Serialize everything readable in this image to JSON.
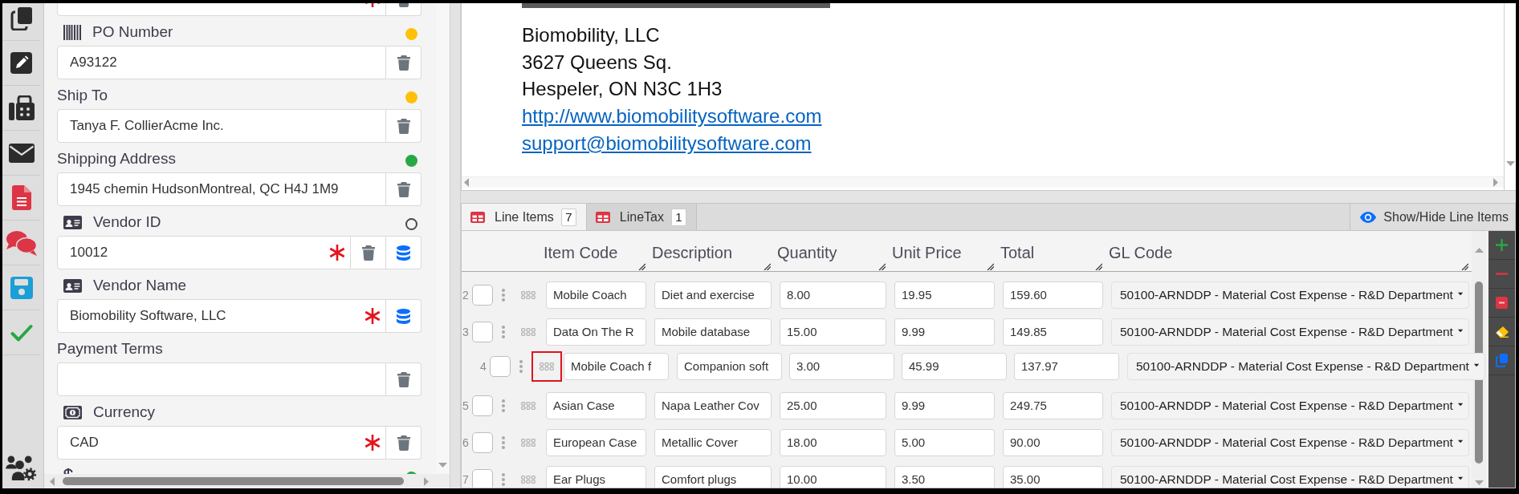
{
  "sidebar": {
    "tools": [
      {
        "kind": "duplicate"
      },
      {
        "kind": "edit"
      },
      {
        "kind": "fax"
      },
      {
        "kind": "email"
      },
      {
        "kind": "pdf"
      },
      {
        "kind": "comments"
      },
      {
        "kind": "save"
      },
      {
        "kind": "approve"
      }
    ],
    "bottom_tool": {
      "kind": "users"
    }
  },
  "form": {
    "fields": [
      {
        "input": {
          "required": true,
          "deletable": true,
          "lookup": false
        }
      },
      {
        "kind": "reference",
        "label": "PO Number",
        "dot": {
          "kind": "filled",
          "color": "#ffc107"
        },
        "input": {
          "value": "A93122",
          "required": false,
          "deletable": true,
          "lookup": false
        }
      },
      {
        "kind": "text",
        "label": "Ship To",
        "dot": {
          "kind": "filled",
          "color": "#ffc107"
        },
        "input": {
          "value": "Tanya F. CollierAcme Inc.",
          "required": false,
          "deletable": true,
          "lookup": false
        }
      },
      {
        "kind": "text",
        "label": "Shipping Address",
        "dot": {
          "kind": "filled",
          "color": "#28a745"
        },
        "input": {
          "value": "1945 chemin HudsonMontreal, QC H4J 1M9",
          "required": false,
          "deletable": true,
          "lookup": false
        }
      },
      {
        "kind": "vendor",
        "label": "Vendor ID",
        "dot": {
          "kind": "hollow",
          "color": "#4a4a4a"
        },
        "input": {
          "value": "10012",
          "required": true,
          "deletable": true,
          "lookup": true
        }
      },
      {
        "kind": "vendor",
        "label": "Vendor Name",
        "input": {
          "value": "Biomobility Software, LLC",
          "required": true,
          "deletable": false,
          "lookup": true
        }
      },
      {
        "kind": "text",
        "label": "Payment Terms",
        "input": {
          "required": false,
          "deletable": true,
          "lookup": false
        }
      },
      {
        "kind": "currency",
        "label": "Currency",
        "input": {
          "value": "CAD",
          "required": true,
          "deletable": true,
          "lookup": false
        }
      },
      {
        "kind": "amount",
        "dot": {
          "kind": "filled",
          "color": "#28a745"
        }
      }
    ]
  },
  "document": {
    "lines": [
      {
        "kind": "text",
        "text": "Biomobility, LLC"
      },
      {
        "kind": "text",
        "text": "3627 Queens Sq."
      },
      {
        "kind": "text",
        "text": "Hespeler, ON N3C 1H3"
      },
      {
        "kind": "link",
        "text": "http://www.biomobilitysoftware.com"
      },
      {
        "kind": "link",
        "text": "support@biomobilitysoftware.com"
      }
    ]
  },
  "line_items": {
    "tabs": [
      {
        "label": "Line Items",
        "count": "7",
        "selected": true
      },
      {
        "label": "LineTax",
        "count": "1",
        "selected": false
      }
    ],
    "show_hide_button": "Show/Hide Line Items",
    "columns": [
      "Item Code",
      "Description",
      "Quantity",
      "Unit Price",
      "Total",
      "GL Code"
    ],
    "rows": [
      {
        "number": "2",
        "checked": false,
        "dragging": false,
        "item_code": "Mobile Coach",
        "description": "Diet and exercise",
        "quantity": "8.00",
        "unit_price": "19.95",
        "total": "159.60",
        "gl_code": "50100-ARNDDP - Material Cost Expense - R&D Department"
      },
      {
        "number": "3",
        "checked": false,
        "dragging": false,
        "item_code": "Data On The R",
        "description": "Mobile database",
        "quantity": "15.00",
        "unit_price": "9.99",
        "total": "149.85",
        "gl_code": "50100-ARNDDP - Material Cost Expense - R&D Department"
      },
      {
        "number": "4",
        "checked": false,
        "dragging": true,
        "item_code": "Mobile Coach f",
        "description": "Companion soft",
        "quantity": "3.00",
        "unit_price": "45.99",
        "total": "137.97",
        "gl_code": "50100-ARNDDP - Material Cost Expense - R&D Department"
      },
      {
        "number": "5",
        "checked": false,
        "dragging": false,
        "item_code": "Asian Case",
        "description": "Napa Leather Cov",
        "quantity": "25.00",
        "unit_price": "9.99",
        "total": "249.75",
        "gl_code": "50100-ARNDDP - Material Cost Expense - R&D Department"
      },
      {
        "number": "6",
        "checked": false,
        "dragging": false,
        "item_code": "European Case",
        "description": "Metallic Cover",
        "quantity": "18.00",
        "unit_price": "5.00",
        "total": "90.00",
        "gl_code": "50100-ARNDDP - Material Cost Expense - R&D Department"
      },
      {
        "number": "7",
        "checked": false,
        "dragging": false,
        "item_code": "Ear Plugs",
        "description": "Comfort plugs",
        "quantity": "10.00",
        "unit_price": "3.50",
        "total": "35.00",
        "gl_code": "50100-ARNDDP - Material Cost Expense - R&D Department"
      }
    ],
    "toolbar": [
      {
        "kind": "add"
      },
      {
        "kind": "remove"
      },
      {
        "kind": "delete"
      },
      {
        "kind": "clear"
      },
      {
        "kind": "copy"
      }
    ]
  }
}
